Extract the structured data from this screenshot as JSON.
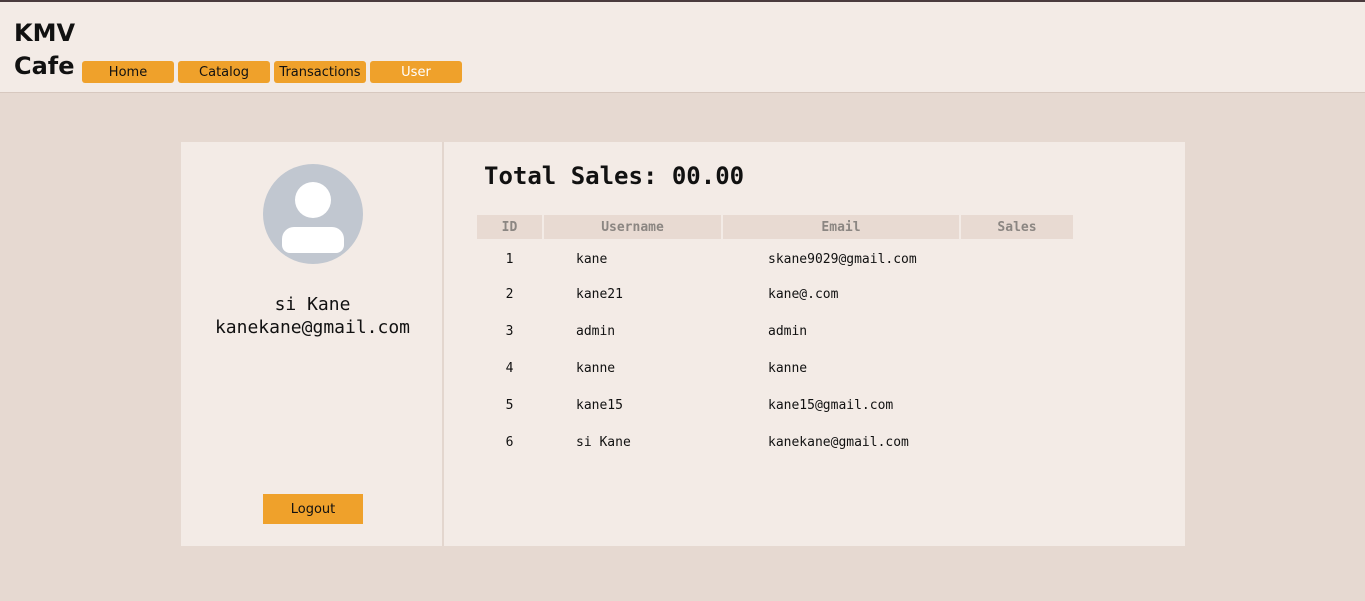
{
  "header": {
    "brand": "KMV Cafe",
    "nav": [
      {
        "label": "Home",
        "active": false
      },
      {
        "label": "Catalog",
        "active": false
      },
      {
        "label": "Transactions",
        "active": false
      },
      {
        "label": "User",
        "active": true
      }
    ]
  },
  "profile": {
    "avatar_icon": "user-avatar-icon",
    "name": "si Kane",
    "email": "kanekane@gmail.com",
    "logout_label": "Logout"
  },
  "main": {
    "total_sales": "Total Sales: 00.00",
    "table": {
      "columns": [
        "ID",
        "Username",
        "Email",
        "Sales"
      ],
      "rows": [
        {
          "id": "1",
          "username": "kane",
          "email": "skane9029@gmail.com",
          "sales": ""
        },
        {
          "id": "2",
          "username": "kane21",
          "email": "kane@.com",
          "sales": ""
        },
        {
          "id": "3",
          "username": "admin",
          "email": "admin",
          "sales": ""
        },
        {
          "id": "4",
          "username": "kanne",
          "email": "kanne",
          "sales": ""
        },
        {
          "id": "5",
          "username": "kane15",
          "email": "kane15@gmail.com",
          "sales": ""
        },
        {
          "id": "6",
          "username": "si Kane",
          "email": "kanekane@gmail.com",
          "sales": ""
        }
      ]
    }
  },
  "colors": {
    "accent": "#efa12b",
    "page_bg": "#e6d9d1",
    "panel_bg": "#f3ebe6",
    "table_header_bg": "#e8dad2"
  }
}
